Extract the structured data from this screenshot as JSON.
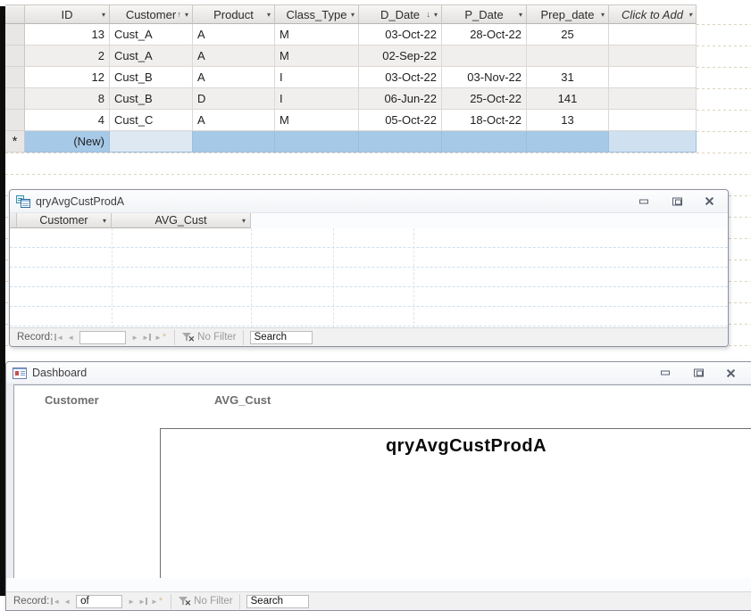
{
  "table": {
    "columns": [
      {
        "label": "ID",
        "sort": null
      },
      {
        "label": "Customer",
        "sort": "asc"
      },
      {
        "label": "Product",
        "sort": null
      },
      {
        "label": "Class_Type",
        "sort": null
      },
      {
        "label": "D_Date",
        "sort": "desc"
      },
      {
        "label": "P_Date",
        "sort": null
      },
      {
        "label": "Prep_date",
        "sort": null
      },
      {
        "label": "Click to Add",
        "sort": null,
        "placeholder": true
      }
    ],
    "rows": [
      {
        "id": "13",
        "customer": "Cust_A",
        "product": "A",
        "class_type": "M",
        "d_date": "03-Oct-22",
        "p_date": "28-Oct-22",
        "prep_date": "25",
        "add": ""
      },
      {
        "id": "2",
        "customer": "Cust_A",
        "product": "A",
        "class_type": "M",
        "d_date": "02-Sep-22",
        "p_date": "",
        "prep_date": "",
        "add": ""
      },
      {
        "id": "12",
        "customer": "Cust_B",
        "product": "A",
        "class_type": "I",
        "d_date": "03-Oct-22",
        "p_date": "03-Nov-22",
        "prep_date": "31",
        "add": ""
      },
      {
        "id": "8",
        "customer": "Cust_B",
        "product": "D",
        "class_type": "I",
        "d_date": "06-Jun-22",
        "p_date": "25-Oct-22",
        "prep_date": "141",
        "add": ""
      },
      {
        "id": "4",
        "customer": "Cust_C",
        "product": "A",
        "class_type": "M",
        "d_date": "05-Oct-22",
        "p_date": "18-Oct-22",
        "prep_date": "13",
        "add": ""
      }
    ],
    "new_row": {
      "marker": "*",
      "id_label": "(New)"
    }
  },
  "query_window": {
    "title": "qryAvgCustProdA",
    "columns": [
      "Customer",
      "AVG_Cust"
    ],
    "record_bar": {
      "label": "Record:",
      "record_value": "",
      "filter_label": "No Filter",
      "search_text": "Search"
    }
  },
  "dashboard_window": {
    "title": "Dashboard",
    "labels": {
      "customer": "Customer",
      "avg_cust": "AVG_Cust"
    },
    "subform_title": "qryAvgCustProdA",
    "record_bar": {
      "label": "Record:",
      "record_value": "of",
      "filter_label": "No Filter",
      "search_text": "Search"
    }
  },
  "colors": {
    "selection_blue": "#a7c9e8",
    "selection_edit": "#dde8f3",
    "alt_row": "#f1efed",
    "header_text": "#2b2b2b",
    "disabled_gray": "#b0afae"
  }
}
